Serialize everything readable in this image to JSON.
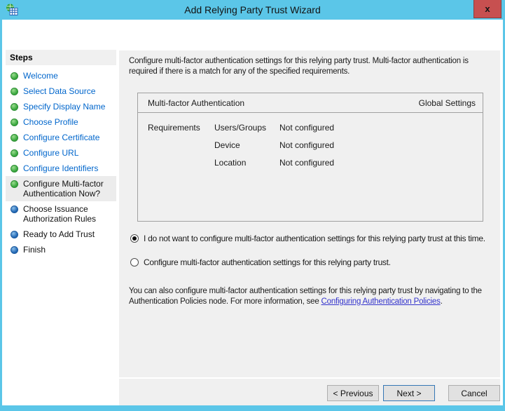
{
  "window": {
    "title": "Add Relying Party Trust Wizard",
    "close_label": "x"
  },
  "sidebar": {
    "header": "Steps",
    "steps": [
      {
        "label": "Welcome",
        "state": "done"
      },
      {
        "label": "Select Data Source",
        "state": "done"
      },
      {
        "label": "Specify Display Name",
        "state": "done"
      },
      {
        "label": "Choose Profile",
        "state": "done"
      },
      {
        "label": "Configure Certificate",
        "state": "done"
      },
      {
        "label": "Configure URL",
        "state": "done"
      },
      {
        "label": "Configure Identifiers",
        "state": "done"
      },
      {
        "label": "Configure Multi-factor Authentication Now?",
        "state": "current"
      },
      {
        "label": "Choose Issuance Authorization Rules",
        "state": "upcoming"
      },
      {
        "label": "Ready to Add Trust",
        "state": "upcoming"
      },
      {
        "label": "Finish",
        "state": "upcoming"
      }
    ]
  },
  "content": {
    "intro": "Configure multi-factor authentication settings for this relying party trust. Multi-factor authentication is required if there is a match for any of the specified requirements.",
    "table": {
      "header_left": "Multi-factor Authentication",
      "header_right": "Global Settings",
      "row_group": "Requirements",
      "rows": [
        {
          "name": "Users/Groups",
          "value": "Not configured"
        },
        {
          "name": "Device",
          "value": "Not configured"
        },
        {
          "name": "Location",
          "value": "Not configured"
        }
      ]
    },
    "radio_skip": "I do not want to configure multi-factor authentication settings for this relying party trust at this time.",
    "radio_skip_selected": true,
    "radio_configure": "Configure multi-factor authentication settings for this relying party trust.",
    "radio_configure_selected": false,
    "footnote_before": "You can also configure multi-factor authentication settings for this relying party trust by navigating to the Authentication Policies node. For more information, see ",
    "footnote_link": "Configuring Authentication Policies",
    "footnote_after": "."
  },
  "footer": {
    "previous": "< Previous",
    "next": "Next >",
    "cancel": "Cancel"
  },
  "colors": {
    "titlebar": "#5bc6e8",
    "close_button": "#c75050",
    "pane_background": "#f0f0f0",
    "step_done_text": "#0066cc",
    "bullet_done": "#3aa83f",
    "bullet_upcoming": "#2268b5",
    "link": "#3333cc",
    "focused_button_border": "#3577b5"
  }
}
